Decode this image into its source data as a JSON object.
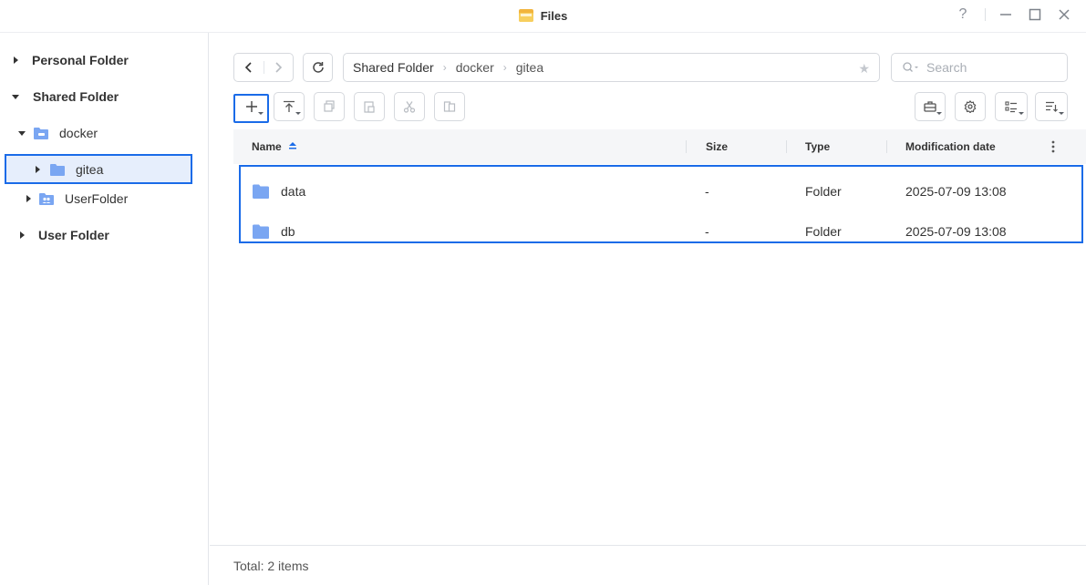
{
  "window": {
    "title": "Files",
    "help_label": "?"
  },
  "sidebar": {
    "items": [
      {
        "label": "Personal Folder"
      },
      {
        "label": "Shared Folder"
      },
      {
        "label": "docker"
      },
      {
        "label": "gitea"
      },
      {
        "label": "UserFolder"
      },
      {
        "label": "User Folder"
      }
    ]
  },
  "path": {
    "crumbs": [
      "Shared Folder",
      "docker",
      "gitea"
    ]
  },
  "search": {
    "placeholder": "Search"
  },
  "table": {
    "columns": [
      "Name",
      "Size",
      "Type",
      "Modification date"
    ],
    "rows": [
      {
        "name": "data",
        "size": "-",
        "type": "Folder",
        "modified": "2025-07-09 13:08"
      },
      {
        "name": "db",
        "size": "-",
        "type": "Folder",
        "modified": "2025-07-09 13:08"
      }
    ]
  },
  "status": {
    "total": "Total: 2 items"
  },
  "colors": {
    "accent": "#1a6be8",
    "folder": "#7aa6f2",
    "selected_bg": "#e6eefc"
  }
}
